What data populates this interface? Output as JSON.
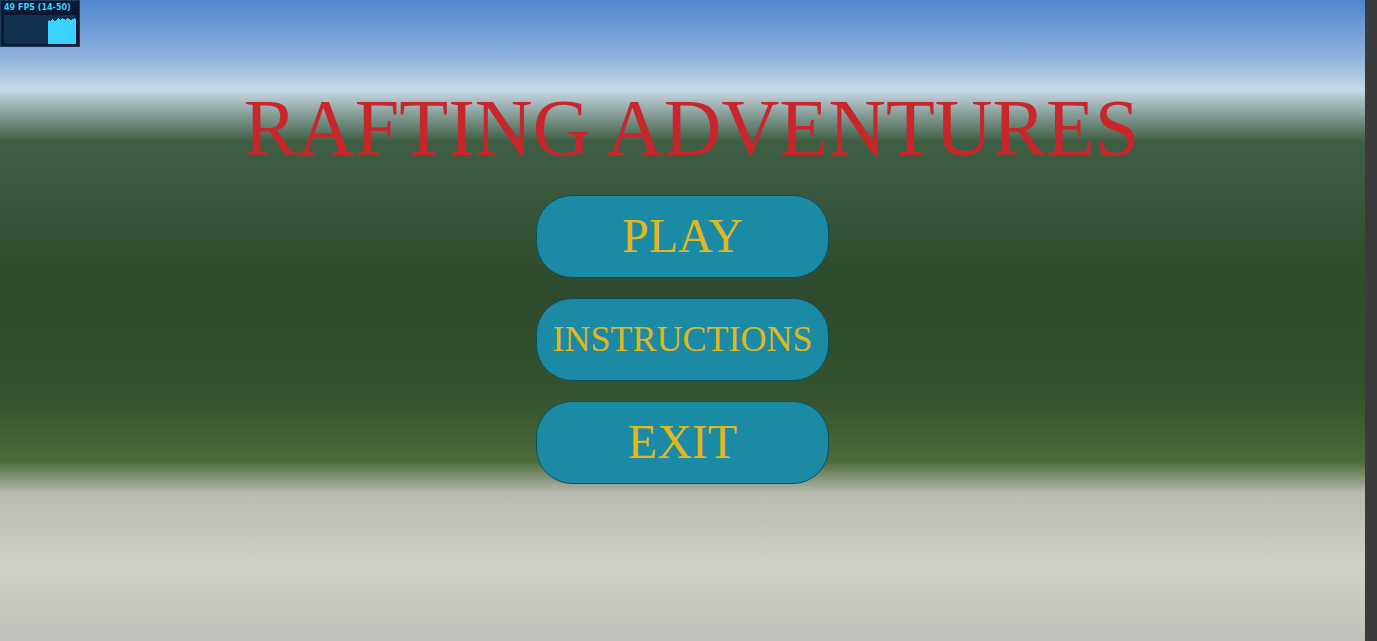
{
  "window": {
    "title": "RAFTING ADVENTURES"
  },
  "fps_meter": {
    "reading": "49 FPS (14-50)",
    "history": [
      44,
      46,
      45,
      47,
      48,
      46,
      45,
      44,
      46,
      49,
      50,
      48,
      47,
      49,
      50,
      49,
      48,
      47,
      49,
      50,
      48,
      49,
      47,
      46,
      48,
      49,
      50,
      49
    ]
  },
  "menu": {
    "buttons": [
      {
        "label": "PLAY"
      },
      {
        "label": "INSTRUCTIONS"
      },
      {
        "label": "EXIT"
      }
    ]
  }
}
